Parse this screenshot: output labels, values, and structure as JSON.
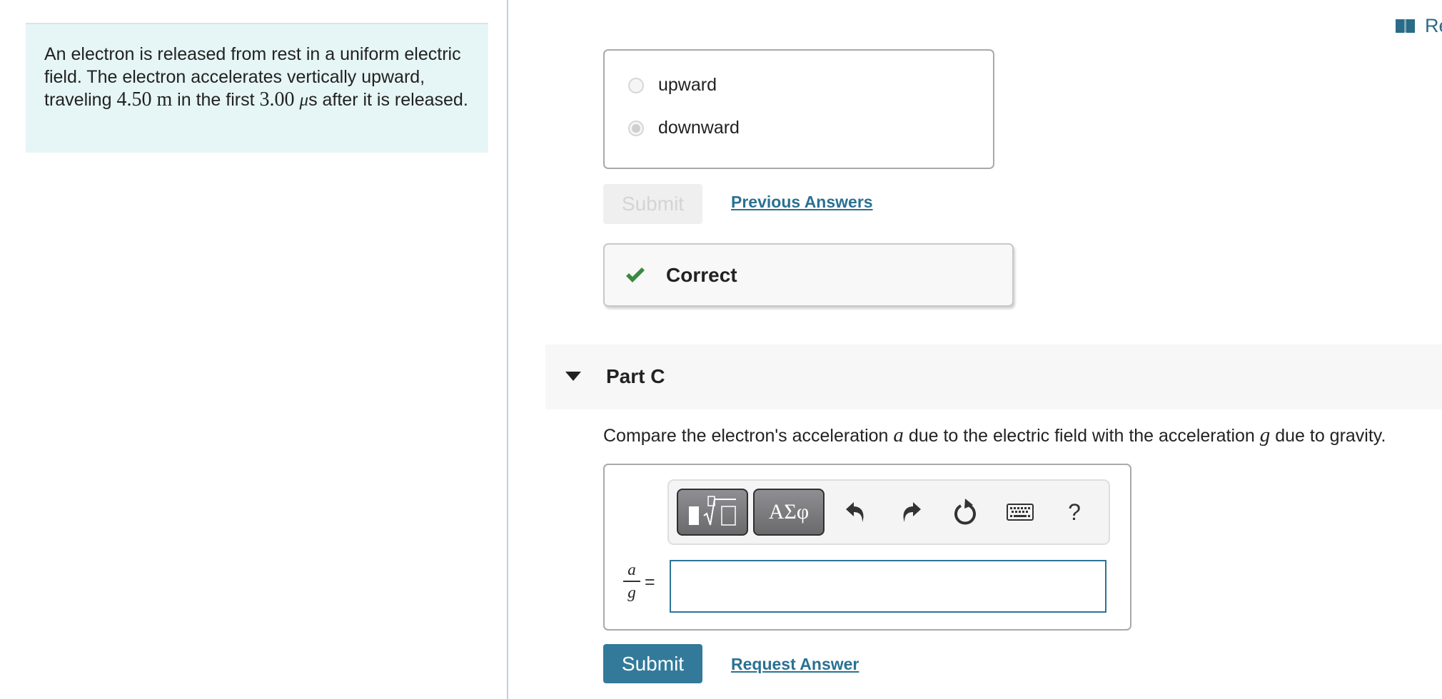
{
  "problem": {
    "text_parts": [
      {
        "type": "text",
        "v": "An electron is released from rest in a uniform electric field. The electron accelerates vertically upward, traveling "
      },
      {
        "type": "math",
        "v": "4.50 m"
      },
      {
        "type": "text",
        "v": " in the first "
      },
      {
        "type": "math",
        "v": "3.00 "
      },
      {
        "type": "mathi",
        "v": "μ"
      },
      {
        "type": "text",
        "v": "s after it is released."
      }
    ]
  },
  "header": {
    "resources_label": "Re",
    "resources_icon": "book-icon"
  },
  "part_b": {
    "options": [
      {
        "label": "upward",
        "selected": false
      },
      {
        "label": "downward",
        "selected": true
      }
    ],
    "submit_label": "Submit",
    "previous_answers_label": "Previous Answers",
    "feedback": {
      "label": "Correct",
      "icon": "checkmark-icon",
      "color": "#3a8a3f"
    }
  },
  "part_c": {
    "title": "Part C",
    "question_parts": [
      {
        "type": "text",
        "v": "Compare the electron's acceleration "
      },
      {
        "type": "mathi",
        "v": "a"
      },
      {
        "type": "text",
        "v": " due to the electric field with the acceleration "
      },
      {
        "type": "mathi",
        "v": "g"
      },
      {
        "type": "text",
        "v": " due to gravity."
      }
    ],
    "toolbar": {
      "templates_icon": "templates-icon",
      "symbols_label": "ΑΣφ",
      "undo_icon": "undo-icon",
      "redo_icon": "redo-icon",
      "reset_icon": "reset-icon",
      "keyboard_icon": "keyboard-icon",
      "help_label": "?"
    },
    "answer_label": {
      "numerator": "a",
      "denominator": "g",
      "equals": "="
    },
    "answer_value": "",
    "submit_label": "Submit",
    "request_answer_label": "Request Answer"
  },
  "colors": {
    "accent": "#337a9a",
    "link": "#2a7193",
    "problem_bg": "#e6f5f5",
    "correct_green": "#3a8a3f"
  }
}
